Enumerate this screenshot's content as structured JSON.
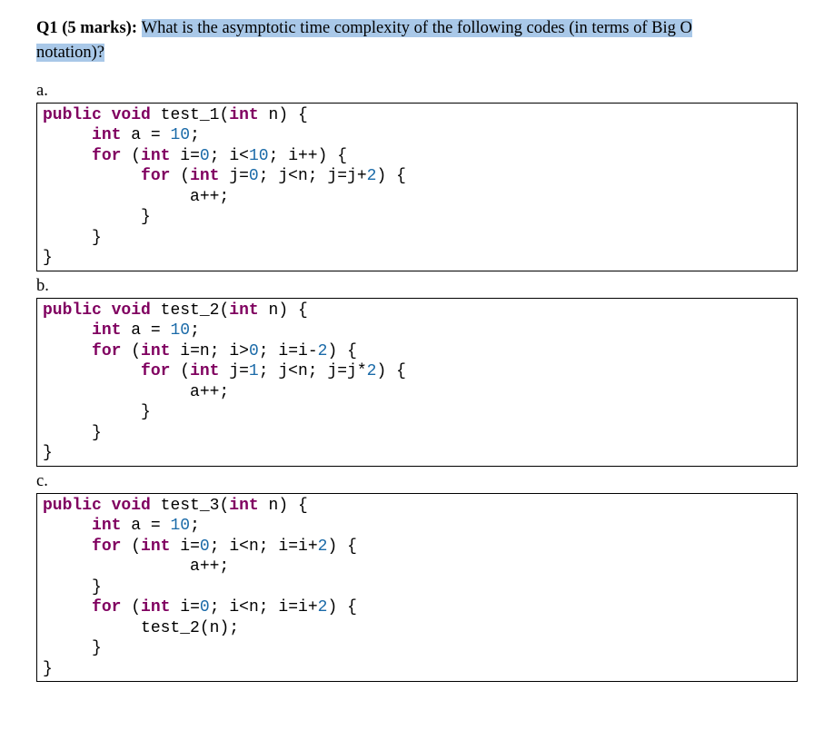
{
  "question": {
    "prefix": "Q1 (5 marks): ",
    "highlighted1": "What is the asymptotic time complexity of the following codes (in terms of Big O",
    "highlighted2": "notation)?"
  },
  "parts": {
    "a": {
      "label": "a."
    },
    "b": {
      "label": "b."
    },
    "c": {
      "label": "c."
    }
  },
  "code_a": {
    "method_name": "test_1",
    "tokens": {
      "public": "public",
      "void": "void",
      "int": "int",
      "for": "for",
      "n": "n",
      "a": "a",
      "i": "i",
      "j": "j",
      "ten": "10",
      "zero": "0",
      "two": "2",
      "open": "{",
      "close": "}",
      "lparen": "(",
      "rparen": ")",
      "semi": ";",
      "eq": "=",
      "lt": "<",
      "pp": "++",
      "plus": "+"
    },
    "body_app": "a++;"
  },
  "code_b": {
    "method_name": "test_2",
    "tokens": {
      "public": "public",
      "void": "void",
      "int": "int",
      "for": "for",
      "n": "n",
      "a": "a",
      "i": "i",
      "j": "j",
      "ten": "10",
      "zero": "0",
      "one": "1",
      "two": "2",
      "open": "{",
      "close": "}",
      "lparen": "(",
      "rparen": ")",
      "semi": ";",
      "eq": "=",
      "lt": "<",
      "gt": ">",
      "minus": "-",
      "star": "*"
    },
    "body_app": "a++;"
  },
  "code_c": {
    "method_name": "test_3",
    "call_name": "test_2",
    "tokens": {
      "public": "public",
      "void": "void",
      "int": "int",
      "for": "for",
      "n": "n",
      "a": "a",
      "i": "i",
      "ten": "10",
      "zero": "0",
      "two": "2",
      "open": "{",
      "close": "}",
      "lparen": "(",
      "rparen": ")",
      "semi": ";",
      "eq": "=",
      "lt": "<",
      "plus": "+"
    },
    "body_app": "a++;"
  }
}
